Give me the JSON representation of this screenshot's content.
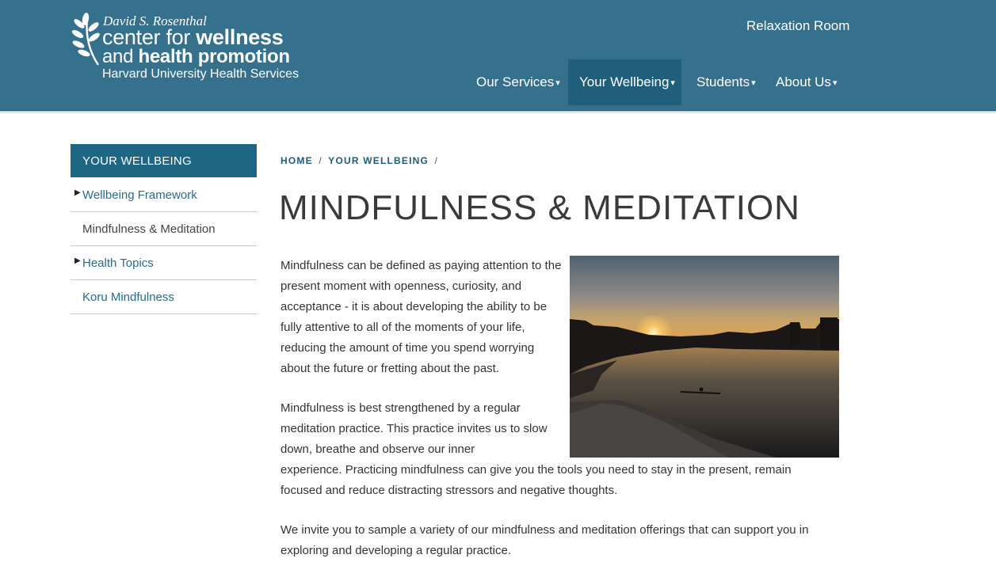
{
  "header": {
    "logo": {
      "line1": "David S. Rosenthal",
      "line2_a": "center for ",
      "line2_b": "wellness",
      "line3_a": "and ",
      "line3_b": "health promotion",
      "line4": "Harvard University Health Services"
    },
    "top_link": "Relaxation Room",
    "nav": [
      {
        "label": "Our Services",
        "caret": "▾",
        "active": false
      },
      {
        "label": "Your Wellbeing",
        "caret": "▾",
        "active": true
      },
      {
        "label": "Students",
        "caret": "▾",
        "active": false
      },
      {
        "label": "About Us",
        "caret": "▾",
        "active": false
      }
    ],
    "background_color": "#35708c",
    "active_nav_color": "#1f5f7c"
  },
  "sidebar": {
    "heading": "YOUR WELLBEING",
    "items": [
      {
        "label": "Wellbeing Framework",
        "has_children": true,
        "current": false
      },
      {
        "label": "Mindfulness & Meditation",
        "has_children": false,
        "current": true
      },
      {
        "label": "Health Topics",
        "has_children": true,
        "current": false
      },
      {
        "label": "Koru Mindfulness",
        "has_children": false,
        "current": false
      }
    ]
  },
  "breadcrumb": {
    "home": "HOME",
    "section": "YOUR WELLBEING",
    "separator": "/"
  },
  "main": {
    "title": "MINDFULNESS & MEDITATION",
    "para1": "Mindfulness can be defined as paying attention to the present moment with openness, curiosity, and acceptance - it is about developing the ability to be fully attentive to all of the moments of your life, reducing the amount of time you spend worrying about the future or fretting about the past.",
    "para2a": "Mindfulness is best strengthened by a regular meditation practice.  This practice invites us to slow down, breathe and observe our inner",
    "para2b": "experience. Practicing mindfulness can give you the tools you need to stay in the present, remain focused and reduce distracting stressors and negative thoughts.",
    "para3": "We invite you to sample a variety of our mindfulness and meditation offerings that can support you in exploring and developing a regular practice."
  },
  "icons": {
    "logo_mark": "leaf-branch-icon",
    "nav_caret": "caret-down-icon",
    "sidebar_arrow": "caret-right-icon"
  }
}
